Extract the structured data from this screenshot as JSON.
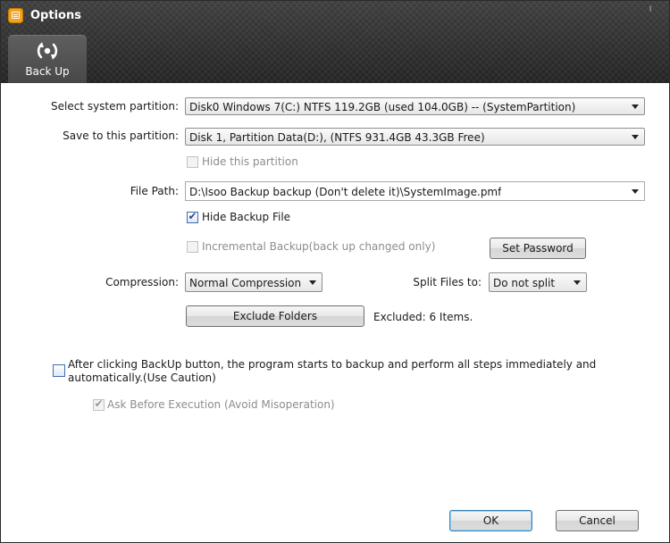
{
  "window": {
    "title": "Options",
    "close_glyph": "ˡ"
  },
  "tabs": [
    {
      "label": "Back Up",
      "icon": "backup-icon"
    }
  ],
  "form": {
    "system_partition": {
      "label": "Select system partition:",
      "value": "Disk0  Windows 7(C:) NTFS 119.2GB (used 104.0GB) -- (SystemPartition)"
    },
    "save_partition": {
      "label": "Save to this partition:",
      "value": "Disk 1, Partition Data(D:), (NTFS 931.4GB 43.3GB Free)"
    },
    "hide_partition": {
      "label": "Hide this partition",
      "checked": false,
      "enabled": false
    },
    "file_path": {
      "label": "File Path:",
      "value": "D:\\Isoo Backup backup (Don't delete it)\\SystemImage.pmf"
    },
    "hide_backup_file": {
      "label": "Hide Backup File",
      "checked": true,
      "enabled": true
    },
    "incremental_backup": {
      "label": "Incremental Backup(back up changed only)",
      "checked": false,
      "enabled": false
    },
    "set_password_label": "Set Password",
    "compression": {
      "label": "Compression:",
      "value": "Normal Compression"
    },
    "split_files": {
      "label": "Split Files to:",
      "value": "Do not split"
    },
    "exclude_folders_label": "Exclude Folders",
    "excluded_text": "Excluded: 6 Items.",
    "immediate_backup": {
      "label_line1": "After clicking BackUp button, the program starts to backup and perform all steps immediately and",
      "label_line2": "automatically.(Use Caution)",
      "checked": false
    },
    "ask_before_execution": {
      "label": "Ask Before Execution (Avoid Misoperation)",
      "checked": true,
      "enabled": false
    }
  },
  "buttons": {
    "ok": "OK",
    "cancel": "Cancel"
  },
  "colors": {
    "titlebar": "#2b2b2b",
    "app_icon": "#f3a21a",
    "default_button_border": "#3c7fb1"
  }
}
